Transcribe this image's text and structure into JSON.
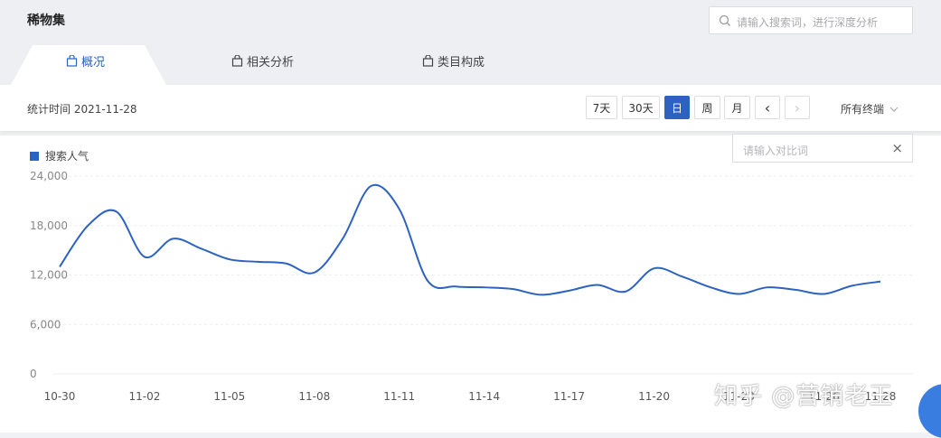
{
  "app": {
    "title": "稀物集"
  },
  "search": {
    "placeholder": "请输入搜索词，进行深度分析"
  },
  "tabs": [
    {
      "label": "概况",
      "active": true
    },
    {
      "label": "相关分析",
      "active": false
    },
    {
      "label": "类目构成",
      "active": false
    }
  ],
  "toolbar": {
    "stat_label": "统计时间 2021-11-28",
    "range_buttons": [
      "7天",
      "30天",
      "日",
      "周",
      "月"
    ],
    "active_range": "日",
    "prev": "‹",
    "next": "›",
    "terminal": "所有终端"
  },
  "compare": {
    "placeholder": "请输入对比词",
    "clear": "×"
  },
  "watermark": "知乎 @营销老王",
  "colors": {
    "accent": "#2d62c0",
    "grid": "#eeeeee"
  },
  "chart_data": {
    "type": "line",
    "series": [
      {
        "name": "搜索人气",
        "values": [
          13000,
          18000,
          19700,
          14200,
          16400,
          15200,
          13900,
          13600,
          13400,
          12300,
          16400,
          22800,
          20000,
          11300,
          10600,
          10500,
          10300,
          9600,
          10100,
          10800,
          10000,
          12800,
          11800,
          10500,
          9700,
          10500,
          10200,
          9700,
          10700,
          11200
        ]
      }
    ],
    "x": [
      "10-30",
      "10-31",
      "11-01",
      "11-02",
      "11-03",
      "11-04",
      "11-05",
      "11-06",
      "11-07",
      "11-08",
      "11-09",
      "11-10",
      "11-11",
      "11-12",
      "11-13",
      "11-14",
      "11-15",
      "11-16",
      "11-17",
      "11-18",
      "11-19",
      "11-20",
      "11-21",
      "11-22",
      "11-23",
      "11-24",
      "11-25",
      "11-26",
      "11-27",
      "11-28"
    ],
    "x_tick_labels": [
      "10-30",
      "11-02",
      "11-05",
      "11-08",
      "11-11",
      "11-14",
      "11-17",
      "11-20",
      "11-23",
      "11-26"
    ],
    "last_tick_visible": "11-28",
    "y_ticks": [
      "0",
      "6,000",
      "12,000",
      "18,000",
      "24,000"
    ],
    "ylim": [
      0,
      24000
    ],
    "grid": true,
    "legend": "top-left"
  }
}
